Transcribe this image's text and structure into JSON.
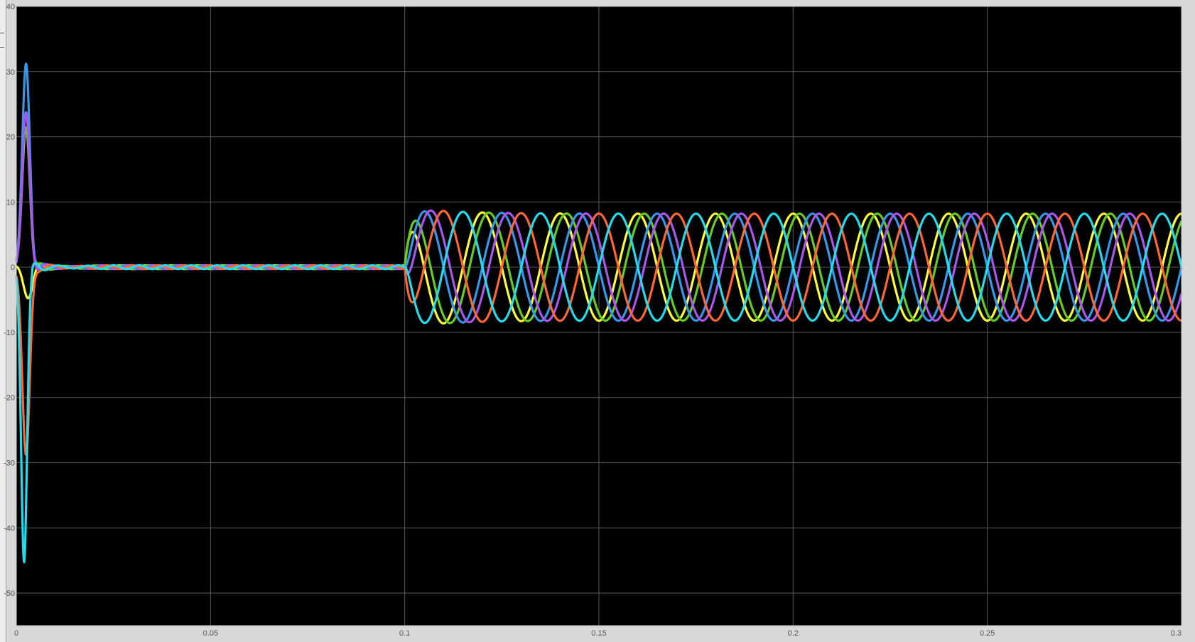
{
  "colors": {
    "background": "#000000",
    "grid": "#5a5a5a",
    "frame": "#c8c8c8",
    "window": "#d8d8d8"
  },
  "chart_data": {
    "type": "line",
    "title": "",
    "xlabel": "",
    "ylabel": "",
    "xlim": [
      0,
      0.3
    ],
    "ylim": [
      -55,
      40
    ],
    "grid": true,
    "legend": "none",
    "x_ticks": [
      0,
      0.05,
      0.1,
      0.15,
      0.2,
      0.25,
      0.3
    ],
    "y_ticks": [
      -50,
      -40,
      -30,
      -20,
      -10,
      0,
      10,
      20,
      30,
      40
    ],
    "x_tick_labels": [
      "0",
      "0.05",
      "0.1",
      "0.15",
      "0.2",
      "0.25",
      "0.3"
    ],
    "y_tick_labels": [
      "-50",
      "-40",
      "-30",
      "-20",
      "-10",
      "0",
      "10",
      "20",
      "30",
      "40"
    ],
    "steady_state": {
      "start_time": 0.1,
      "frequency_hz": 50,
      "amplitude": 8.2,
      "first_peak_amplitude": 9.2
    },
    "series": [
      {
        "color": "#ffff33",
        "phase_deg": 90,
        "startup_peak": -4.5,
        "startup_peak_time": 0.003
      },
      {
        "color": "#66cc22",
        "phase_deg": 60,
        "startup_peak": 21.5,
        "startup_peak_time": 0.0025
      },
      {
        "color": "#3399ee",
        "phase_deg": 0,
        "startup_peak": 31,
        "startup_peak_time": 0.0025
      },
      {
        "color": "#aa55ee",
        "phase_deg": -30,
        "startup_peak": 23.5,
        "startup_peak_time": 0.0025
      },
      {
        "color": "#ff6633",
        "phase_deg": -90,
        "startup_peak": -29,
        "startup_peak_time": 0.0025
      },
      {
        "color": "#22ddee",
        "phase_deg": 180,
        "startup_peak": -45,
        "startup_peak_time": 0.002
      }
    ]
  }
}
